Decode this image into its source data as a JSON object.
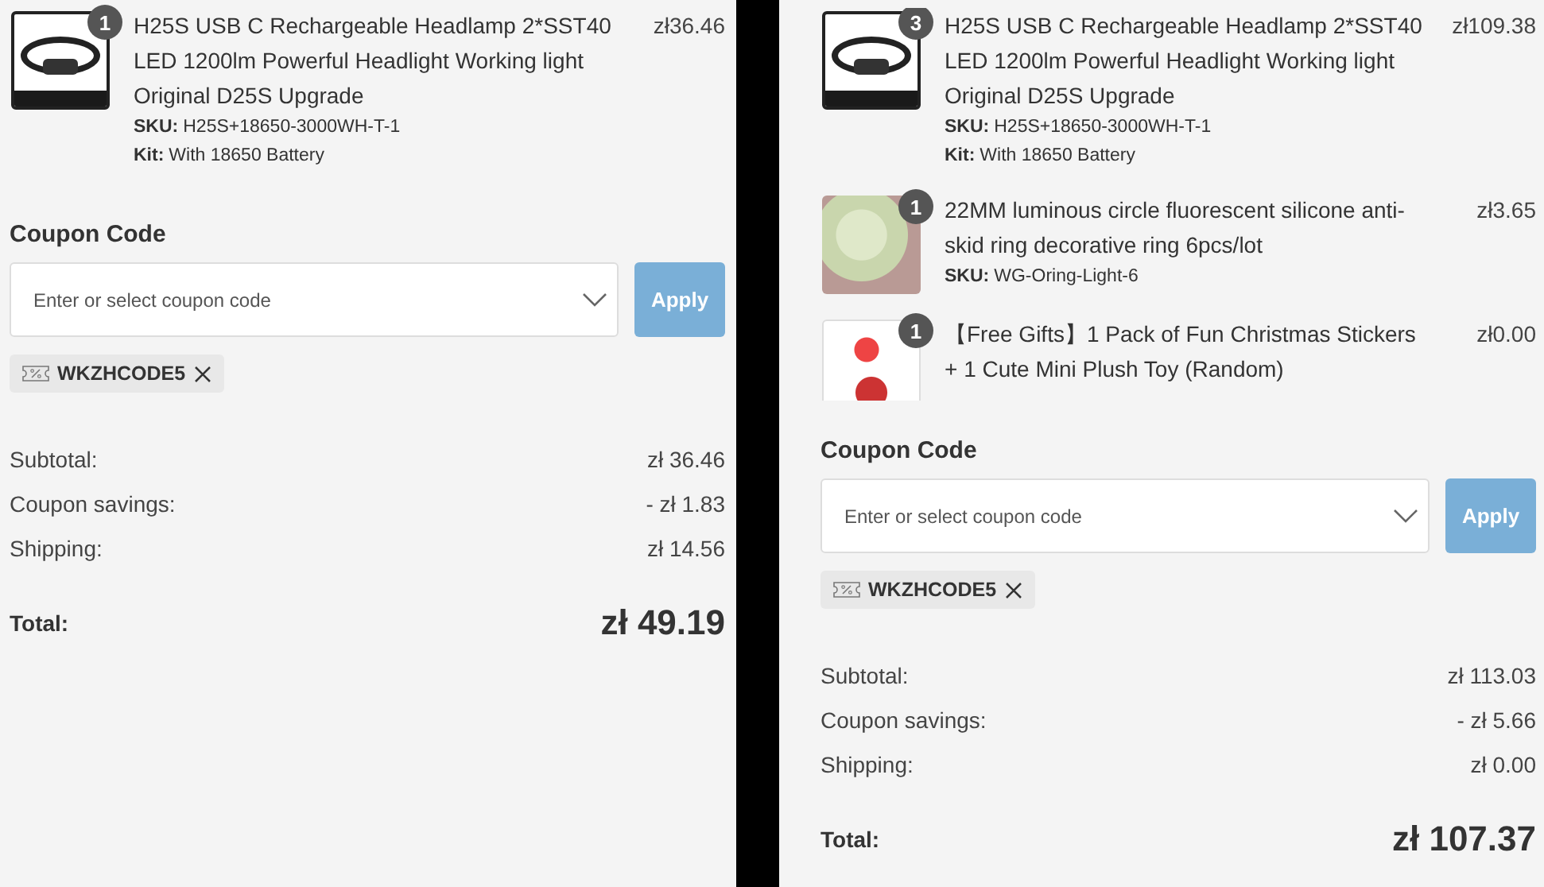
{
  "panels": [
    {
      "items": [
        {
          "quantity": "1",
          "title": "H25S USB C Rechargeable Headlamp 2*SST40 LED 1200lm Powerful Headlight Working light Original D25S Upgrade",
          "price": "zł36.46",
          "kind": "headlamp",
          "attributes": [
            {
              "label": "SKU:",
              "value": "H25S+18650-3000WH-T-1"
            },
            {
              "label": "Kit:",
              "value": "With 18650 Battery"
            }
          ]
        }
      ],
      "coupon": {
        "label": "Coupon Code",
        "placeholder": "Enter or select coupon code",
        "button": "Apply",
        "applied_code": "WKZHCODE5"
      },
      "summary": [
        {
          "label": "Subtotal:",
          "value": "zł 36.46"
        },
        {
          "label": "Coupon savings:",
          "value": "- zł 1.83"
        },
        {
          "label": "Shipping:",
          "value": "zł 14.56"
        }
      ],
      "total": {
        "label": "Total:",
        "value": "zł 49.19"
      }
    },
    {
      "items": [
        {
          "quantity": "3",
          "title": "H25S USB C Rechargeable Headlamp 2*SST40 LED 1200lm Powerful Headlight Working light Original D25S Upgrade",
          "price": "zł109.38",
          "kind": "headlamp",
          "attributes": [
            {
              "label": "SKU:",
              "value": "H25S+18650-3000WH-T-1"
            },
            {
              "label": "Kit:",
              "value": "With 18650 Battery"
            }
          ]
        },
        {
          "quantity": "1",
          "title": "22MM luminous circle fluorescent silicone anti-skid ring decorative ring 6pcs/lot",
          "price": "zł3.65",
          "kind": "rings",
          "attributes": [
            {
              "label": "SKU:",
              "value": "WG-Oring-Light-6"
            }
          ]
        },
        {
          "quantity": "1",
          "title": "【Free Gifts】1 Pack of Fun Christmas Stickers + 1 Cute Mini Plush Toy (Random)",
          "price": "zł0.00",
          "kind": "stickers"
        }
      ],
      "coupon": {
        "label": "Coupon Code",
        "placeholder": "Enter or select coupon code",
        "button": "Apply",
        "applied_code": "WKZHCODE5"
      },
      "summary": [
        {
          "label": "Subtotal:",
          "value": "zł 113.03"
        },
        {
          "label": "Coupon savings:",
          "value": "- zł 5.66"
        },
        {
          "label": "Shipping:",
          "value": "zł 0.00"
        }
      ],
      "total": {
        "label": "Total:",
        "value": "zł 107.37"
      }
    }
  ]
}
